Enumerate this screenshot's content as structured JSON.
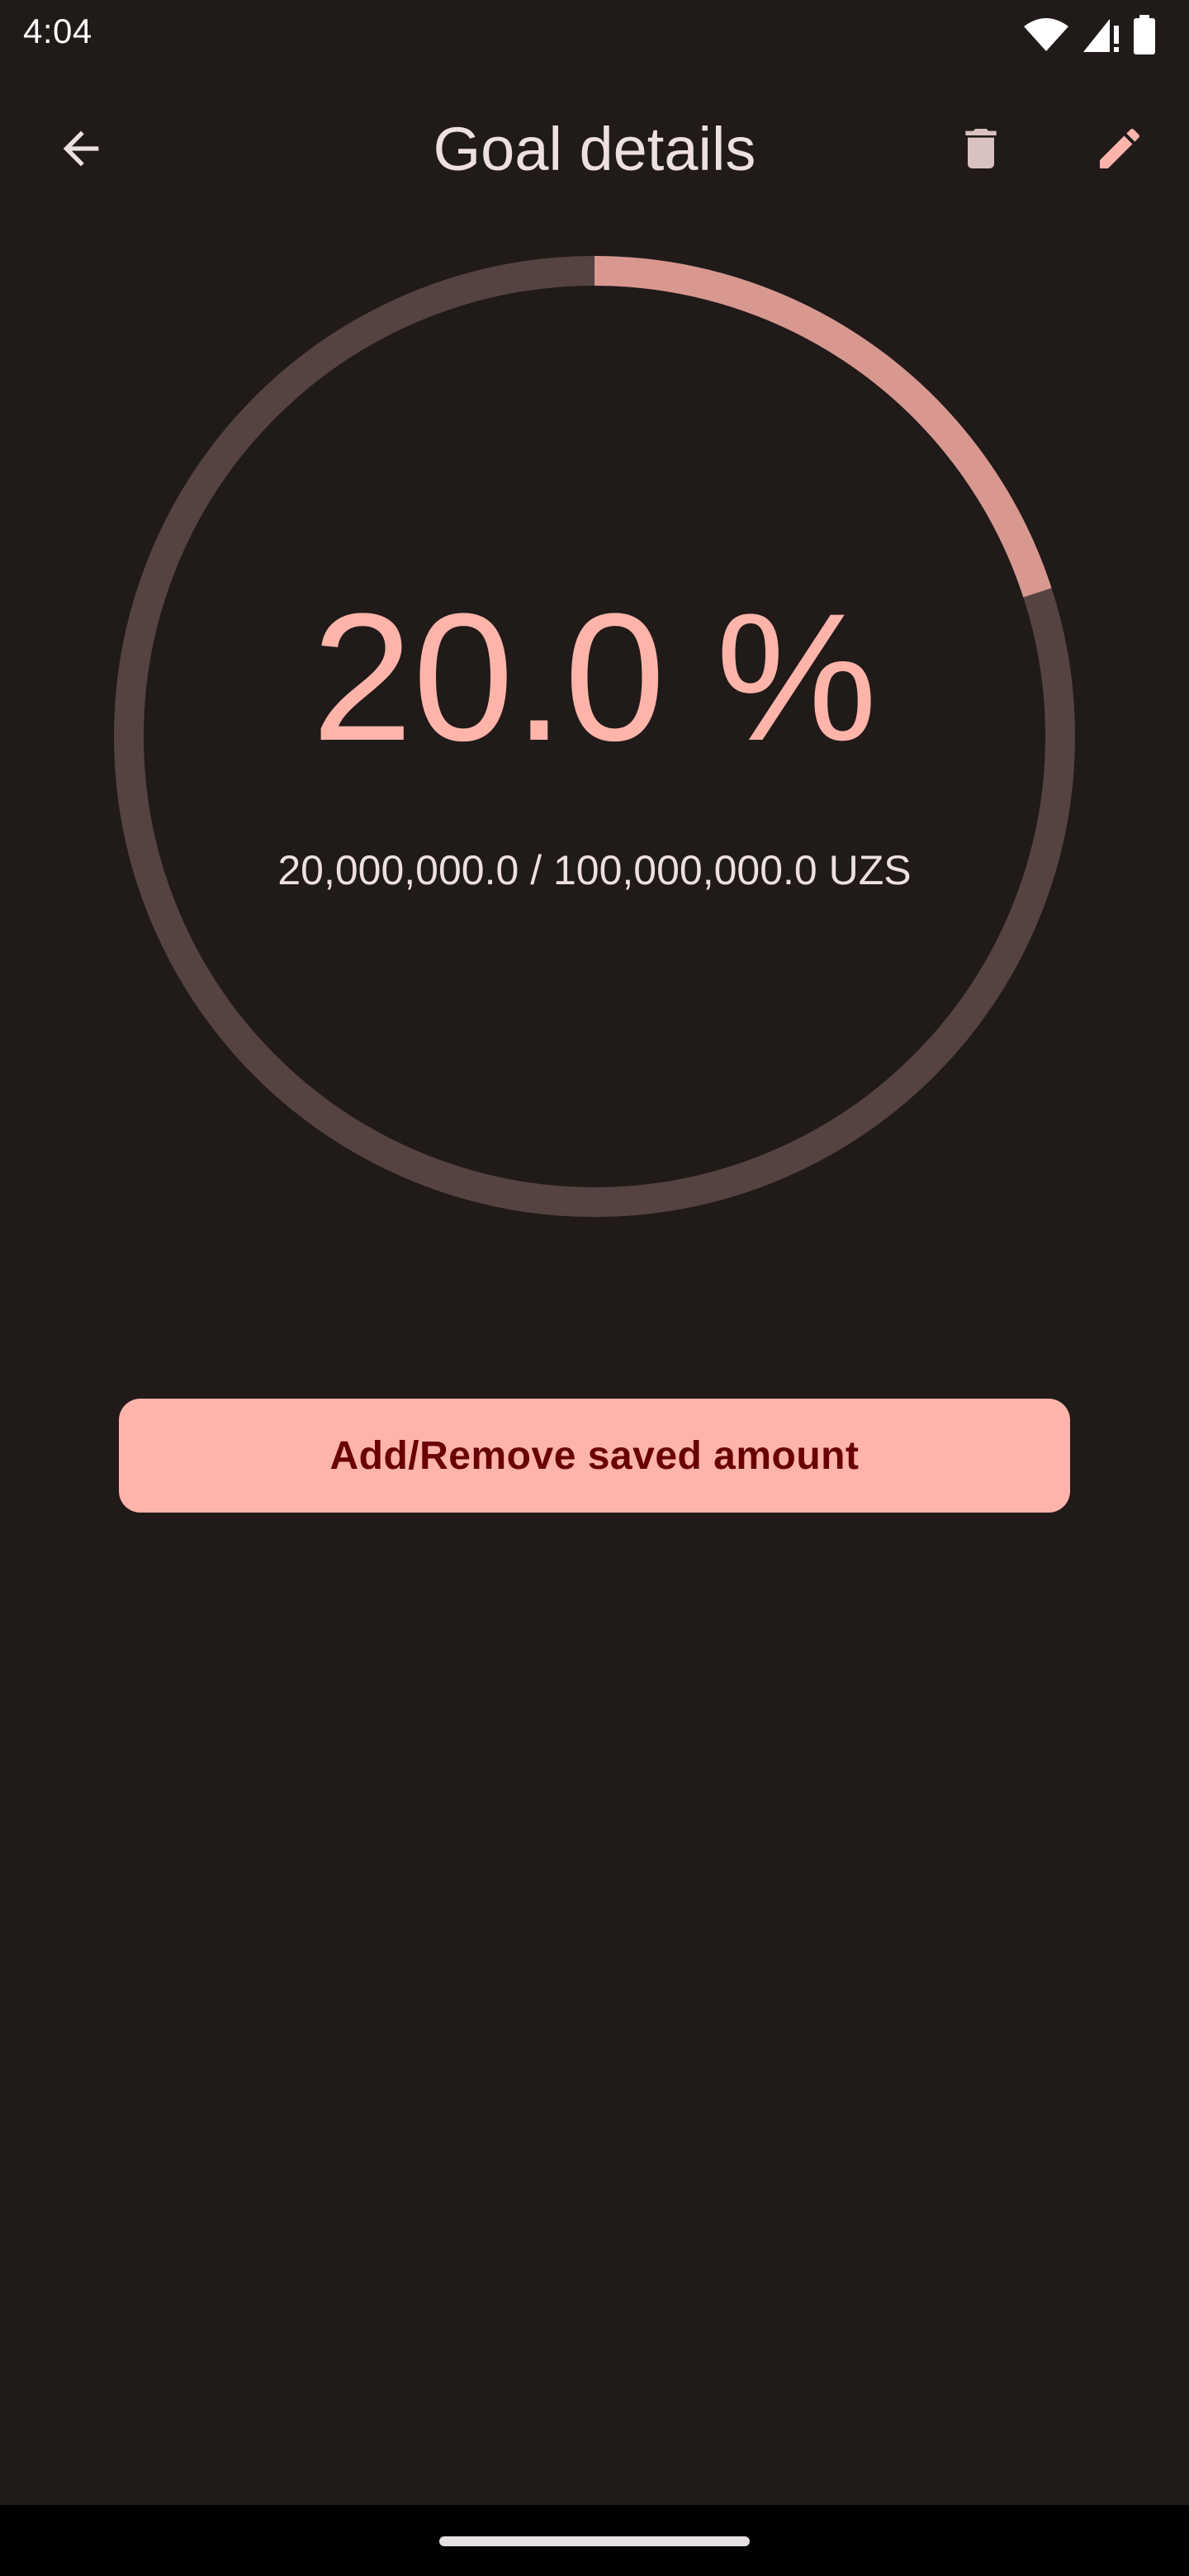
{
  "status_bar": {
    "time": "4:04",
    "icons": [
      "wifi-icon",
      "signal-icon",
      "battery-icon"
    ]
  },
  "app_bar": {
    "title": "Goal details",
    "back_icon": "arrow-back-icon",
    "delete_icon": "trash-icon",
    "edit_icon": "pencil-icon"
  },
  "goal": {
    "percent_label": "20.0 %",
    "progress": 0.2,
    "amount_label": "20,000,000.0 / 100,000,000.0 UZS"
  },
  "action": {
    "label": "Add/Remove saved amount"
  },
  "colors": {
    "background": "#201a19",
    "accent": "#ffb4ab",
    "progress_fill": "#d89890",
    "track": "#544341",
    "on_accent": "#690005"
  }
}
